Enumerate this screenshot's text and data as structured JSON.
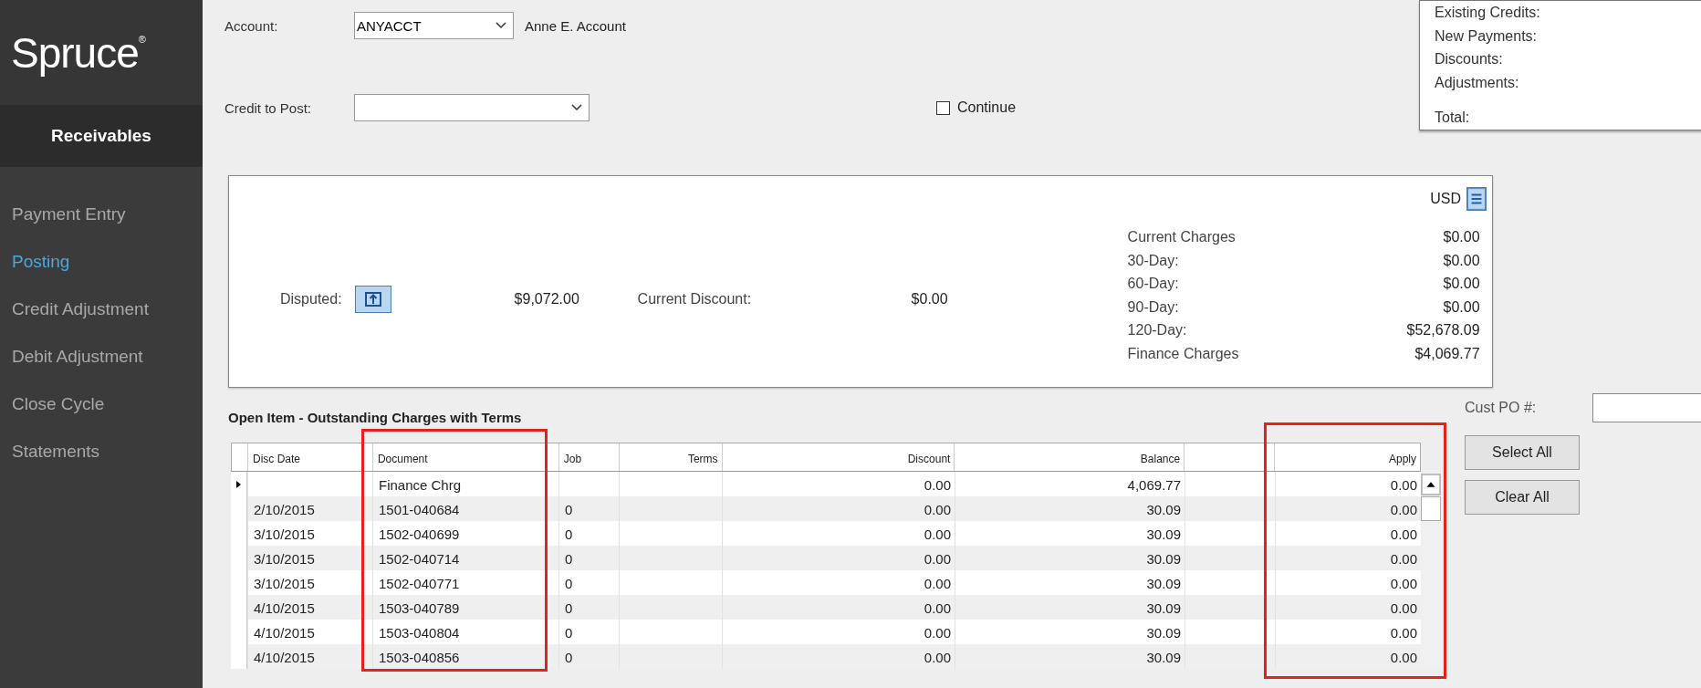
{
  "sidebar": {
    "logo": "Spruce$^{®}$",
    "module": "Receivables",
    "items": [
      {
        "label": "Payment Entry",
        "selected": false
      },
      {
        "label": "Posting",
        "selected": true
      },
      {
        "label": "Credit Adjustment",
        "selected": false
      },
      {
        "label": "Debit Adjustment",
        "selected": false
      },
      {
        "label": "Close Cycle",
        "selected": false
      },
      {
        "label": "Statements",
        "selected": false
      }
    ]
  },
  "account": {
    "label": "Account:",
    "value": "ANYACCT",
    "name": "Anne E. Account"
  },
  "credit_to_post": {
    "label": "Credit to Post:"
  },
  "continue": {
    "label": "Continue",
    "checked": false
  },
  "summary": {
    "labels": [
      "Existing Credits:",
      "New Payments:",
      "Discounts:",
      "Adjustments:",
      "Total:"
    ]
  },
  "balance_panel": {
    "currency": "USD",
    "disputed_label": "Disputed:",
    "amount": "$9,072.00",
    "discount_label": "Current Discount:",
    "discount_value": "$0.00",
    "aging": [
      {
        "label": "Current Charges",
        "value": "$0.00"
      },
      {
        "label": "30-Day:",
        "value": "$0.00"
      },
      {
        "label": "60-Day:",
        "value": "$0.00"
      },
      {
        "label": "90-Day:",
        "value": "$0.00"
      },
      {
        "label": "120-Day:",
        "value": "$52,678.09"
      },
      {
        "label": "Finance Charges",
        "value": "$4,069.77"
      }
    ]
  },
  "grid": {
    "title": "Open Item - Outstanding Charges with Terms",
    "cust_po_label": "Cust PO #:",
    "columns": [
      {
        "label": "Disc Date",
        "highlighted": false
      },
      {
        "label": "Document",
        "highlighted": true
      },
      {
        "label": "Job",
        "highlighted": false
      },
      {
        "label": "Terms",
        "highlighted": false
      },
      {
        "label": "Discount",
        "highlighted": false
      },
      {
        "label": "Balance",
        "highlighted": false
      },
      {
        "highlighted": false
      },
      {
        "label": "Apply",
        "highlighted": true
      }
    ],
    "rows": [
      {
        "current": true,
        "document": "Finance Chrg",
        "discount": "0.00",
        "balance": "4,069.77",
        "apply": "0.00"
      },
      {
        "current": false,
        "disc_date": "2/10/2015",
        "document": "1501-040684",
        "job": "0",
        "discount": "0.00",
        "balance": "30.09",
        "apply": "0.00"
      },
      {
        "current": false,
        "disc_date": "3/10/2015",
        "document": "1502-040699",
        "job": "0",
        "discount": "0.00",
        "balance": "30.09",
        "apply": "0.00"
      },
      {
        "current": false,
        "disc_date": "3/10/2015",
        "document": "1502-040714",
        "job": "0",
        "discount": "0.00",
        "balance": "30.09",
        "apply": "0.00"
      },
      {
        "current": false,
        "disc_date": "3/10/2015",
        "document": "1502-040771",
        "job": "0",
        "discount": "0.00",
        "balance": "30.09",
        "apply": "0.00"
      },
      {
        "current": false,
        "disc_date": "4/10/2015",
        "document": "1503-040789",
        "job": "0",
        "discount": "0.00",
        "balance": "30.09",
        "apply": "0.00"
      },
      {
        "current": false,
        "disc_date": "4/10/2015",
        "document": "1503-040804",
        "job": "0",
        "discount": "0.00",
        "balance": "30.09",
        "apply": "0.00"
      },
      {
        "current": false,
        "disc_date": "4/10/2015",
        "document": "1503-040856",
        "job": "0",
        "discount": "0.00",
        "balance": "30.09",
        "apply": "0.00"
      }
    ],
    "buttons": [
      "Select All",
      "Clear All"
    ]
  }
}
